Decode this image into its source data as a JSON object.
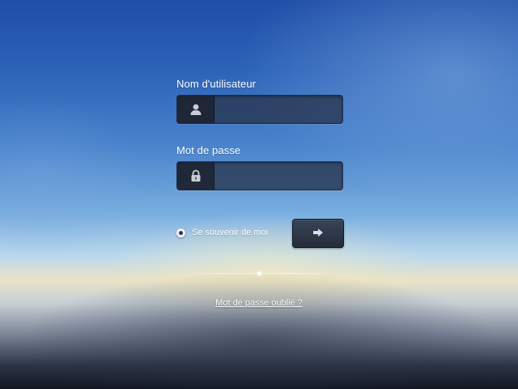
{
  "login": {
    "username": {
      "label": "Nom d'utilisateur",
      "value": "",
      "placeholder": "",
      "icon": "user-icon"
    },
    "password": {
      "label": "Mot de passe",
      "value": "",
      "placeholder": "",
      "icon": "lock-icon"
    },
    "remember": {
      "label": "Se souvenir de moi",
      "checked": true
    },
    "submit": {
      "icon": "arrow-right-icon"
    },
    "forgot_link": "Mot de passe oublié ?"
  },
  "colors": {
    "field_bg": "#2d3a57",
    "icon_box_bg": "#1e2432",
    "button_bg": "#2f3747",
    "text": "#ffffff",
    "sky_top": "#1f4ea8",
    "horizon": "#e9e3c6"
  }
}
